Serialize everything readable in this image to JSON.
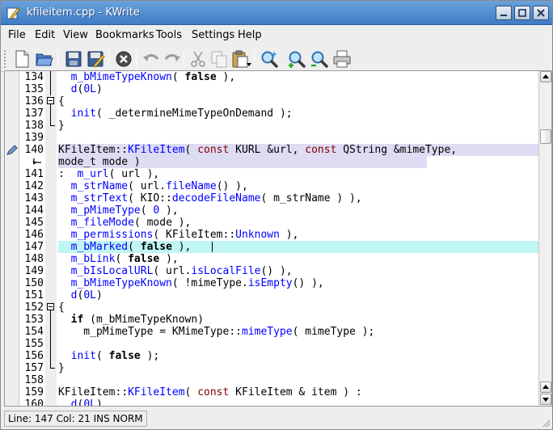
{
  "window": {
    "title": "kfileitem.cpp - KWrite"
  },
  "menubar": {
    "items": [
      {
        "label": "File"
      },
      {
        "label": "Edit"
      },
      {
        "label": "View"
      },
      {
        "label": "Bookmarks"
      },
      {
        "label": "Tools"
      },
      {
        "label": "Settings"
      },
      {
        "label": "Help"
      }
    ]
  },
  "toolbar": {
    "icons": [
      "new-document-icon",
      "open-folder-icon",
      "save-icon",
      "save-as-icon",
      "close-icon",
      "undo-icon",
      "redo-icon",
      "cut-icon",
      "copy-icon",
      "paste-icon",
      "find-icon",
      "zoom-in-icon",
      "zoom-out-icon",
      "print-icon"
    ]
  },
  "editor": {
    "lines": [
      {
        "num": "134",
        "text": "  m_bMimeTypeKnown( false ),"
      },
      {
        "num": "135",
        "text": "  d(0L)"
      },
      {
        "num": "136",
        "text": "{"
      },
      {
        "num": "137",
        "text": "  init( _determineMimeTypeOnDemand );"
      },
      {
        "num": "138",
        "text": "}"
      },
      {
        "num": "139",
        "text": ""
      },
      {
        "num": "140",
        "text": "KFileItem::KFileItem( const KURL &url, const QString &mimeType,"
      },
      {
        "num": "",
        "text": "mode_t mode )"
      },
      {
        "num": "141",
        "text": ":  m_url( url ),"
      },
      {
        "num": "142",
        "text": "  m_strName( url.fileName() ),"
      },
      {
        "num": "143",
        "text": "  m_strText( KIO::decodeFileName( m_strName ) ),"
      },
      {
        "num": "144",
        "text": "  m_pMimeType( 0 ),"
      },
      {
        "num": "145",
        "text": "  m_fileMode( mode ),"
      },
      {
        "num": "146",
        "text": "  m_permissions( KFileItem::Unknown ),"
      },
      {
        "num": "147",
        "text": "  m_bMarked( false ),"
      },
      {
        "num": "148",
        "text": "  m_bLink( false ),"
      },
      {
        "num": "149",
        "text": "  m_bIsLocalURL( url.isLocalFile() ),"
      },
      {
        "num": "150",
        "text": "  m_bMimeTypeKnown( !mimeType.isEmpty() ),"
      },
      {
        "num": "151",
        "text": "  d(0L)"
      },
      {
        "num": "152",
        "text": "{"
      },
      {
        "num": "153",
        "text": "  if (m_bMimeTypeKnown)"
      },
      {
        "num": "154",
        "text": "    m_pMimeType = KMimeType::mimeType( mimeType );"
      },
      {
        "num": "155",
        "text": ""
      },
      {
        "num": "156",
        "text": "  init( false );"
      },
      {
        "num": "157",
        "text": "}"
      },
      {
        "num": "158",
        "text": ""
      },
      {
        "num": "159",
        "text": "KFileItem::KFileItem( const KFileItem & item ) :"
      },
      {
        "num": "160",
        "text": "  d(0L)"
      }
    ]
  },
  "status": {
    "text": "Line: 147 Col: 21  INS  NORM"
  },
  "colors": {
    "selection": "#dedcf3",
    "current_line": "#bff5f3",
    "keyword_type": "#800000",
    "function": "#0000ff"
  }
}
